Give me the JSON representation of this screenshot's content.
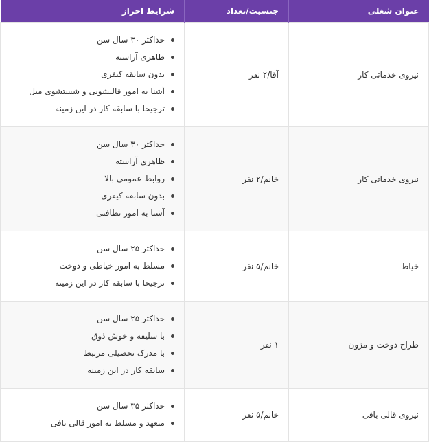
{
  "headers": {
    "title": "عنوان شغلی",
    "gender_count": "جنسیت/تعداد",
    "requirements": "شرایط احراز"
  },
  "rows": [
    {
      "title": "نیروی خدماتی کار",
      "gender_count": "آقا/۲ نفر",
      "requirements": [
        "حداکثر ۳۰ سال سن",
        "ظاهری آراسته",
        "بدون سابقه کیفری",
        "آشنا به امور قالیشویی و شستشوی مبل",
        "ترجیحا با سابقه کار در این زمینه"
      ]
    },
    {
      "title": "نیروی خدماتی کار",
      "gender_count": "خانم/۲ نفر",
      "requirements": [
        "حداکثر ۳۰ سال سن",
        "ظاهری آراسته",
        "روابط عمومی بالا",
        "بدون سابقه کیفری",
        "آشنا به امور نظافتی"
      ]
    },
    {
      "title": "خیاط",
      "gender_count": "خانم/۵ نفر",
      "requirements": [
        "حداکثر ۲۵ سال سن",
        "مسلط به امور خیاطی و دوخت",
        "ترجیحا با سابقه کار در این زمینه"
      ]
    },
    {
      "title": "طراح دوخت و مزون",
      "gender_count": "۱ نفر",
      "requirements": [
        "حداکثر ۲۵ سال سن",
        "با سلیقه و خوش ذوق",
        "با مدرک تحصیلی مرتبط",
        "سابقه کار در این زمینه"
      ]
    },
    {
      "title": "نیروی قالی بافی",
      "gender_count": "خانم/۵ نفر",
      "requirements": [
        "حداکثر ۳۵ سال سن",
        "متعهد و مسلط به امور قالی بافی"
      ]
    }
  ]
}
